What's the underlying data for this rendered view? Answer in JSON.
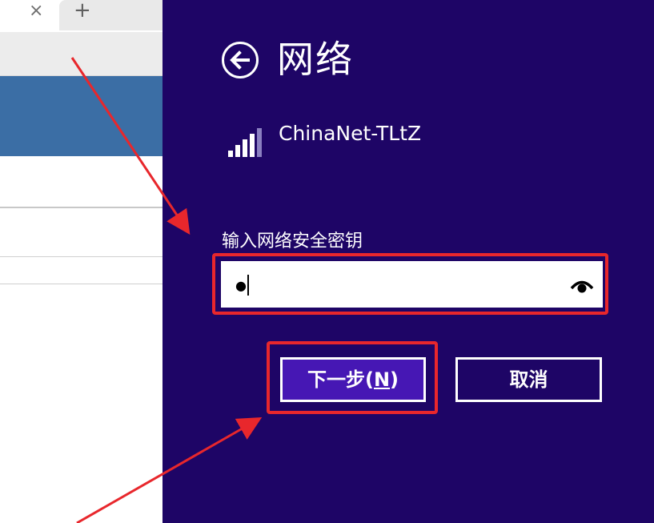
{
  "browser": {
    "tab_close_glyph": "×",
    "new_tab_glyph": "+"
  },
  "network_panel": {
    "title": "网络",
    "network": {
      "ssid": "ChinaNet-TLtZ",
      "signal_bars": 5,
      "signal_bars_lit": 4
    },
    "security_key": {
      "label": "输入网络安全密钥",
      "masked_value": "●"
    },
    "buttons": {
      "next_label_prefix": "下一步(",
      "next_label_mnemonic": "N",
      "next_label_suffix": ")",
      "cancel_label": "取消"
    }
  },
  "colors": {
    "panel_bg": "#1e0566",
    "primary_button": "#4617b4",
    "annotation_red": "#e8272c",
    "banner_blue": "#3b6ea5"
  },
  "icons": {
    "back": "arrow-left-circle-icon",
    "signal": "wifi-signal-icon",
    "reveal": "eye-icon"
  }
}
